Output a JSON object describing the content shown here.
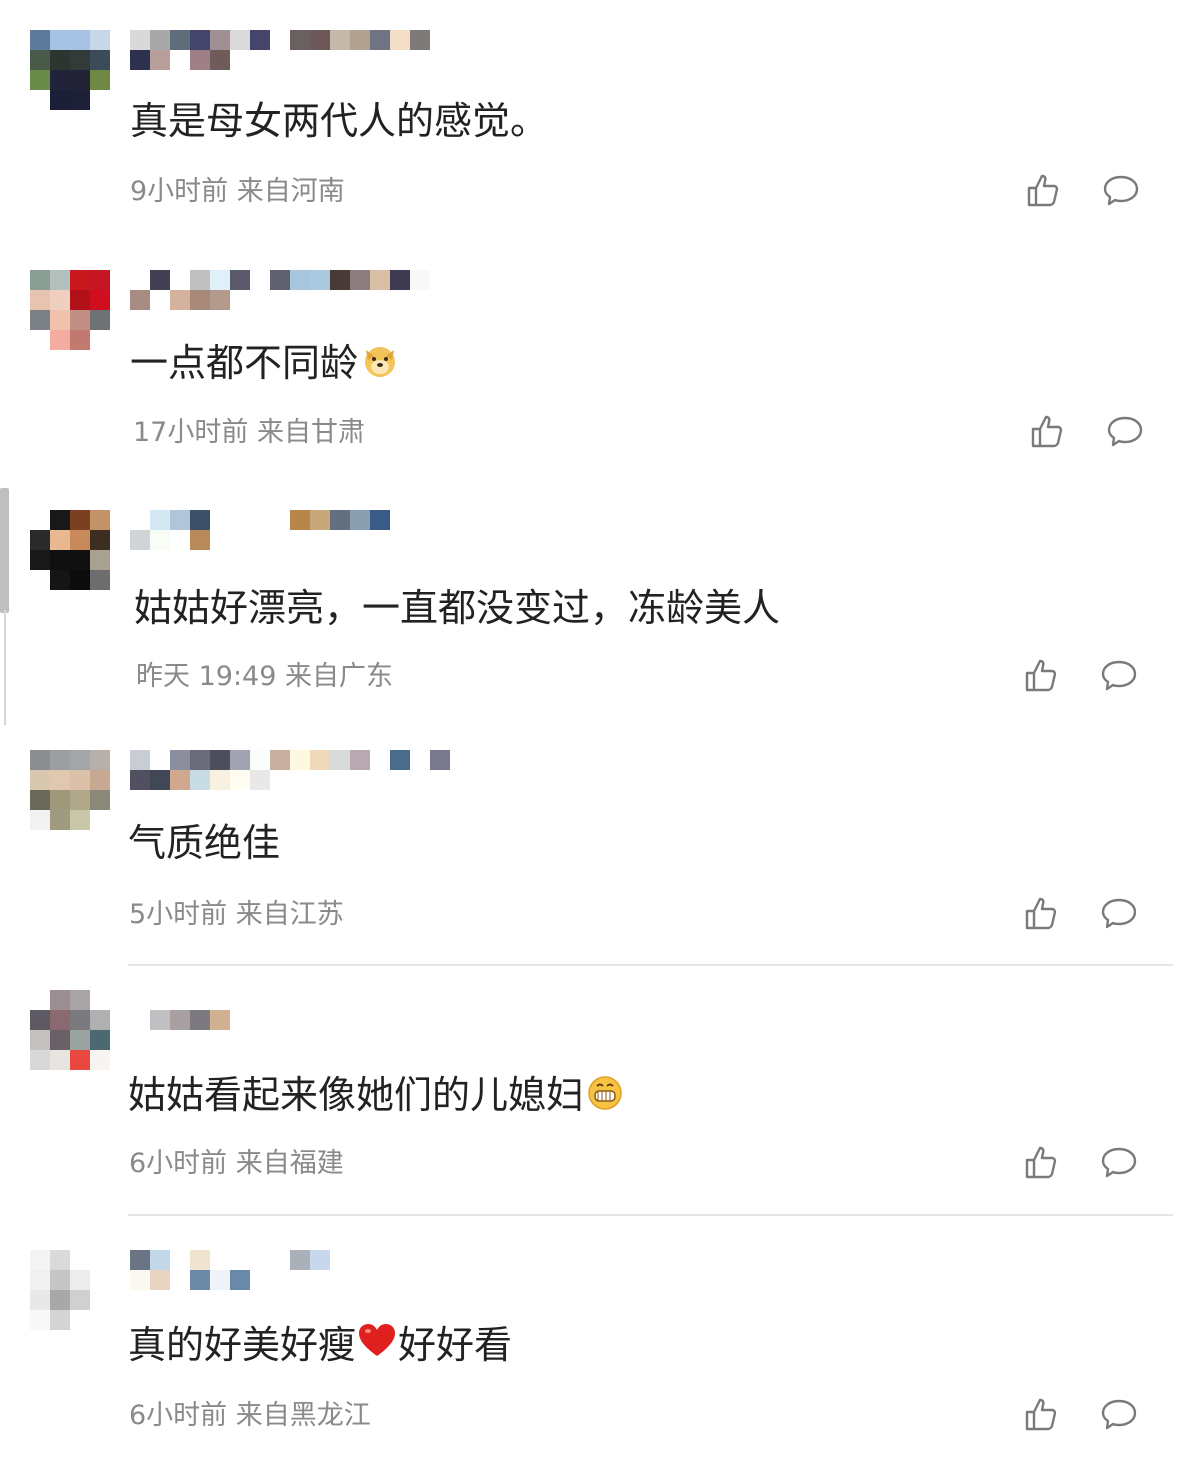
{
  "comments": [
    {
      "text": "真是母女两代人的感觉。",
      "meta": "9小时前 来自河南",
      "avatar": [
        "#5d7a9d",
        "#a7c3e4",
        "#a6c3e4",
        "#c7d7ea",
        "#4a5a48",
        "#2d3530",
        "#333a3a",
        "#3b4b57",
        "#6a8a4a",
        "#21233a",
        "#232338",
        "#6f8844",
        "#ffffff",
        "#1c1f38",
        "#1e2038",
        "#ffffff"
      ],
      "name": [
        "#d9d9d9",
        "#a8a8a8",
        "#5f6c7a",
        "#45446a",
        "#a08f94",
        "#dadada",
        "#45446a",
        "#ffffff",
        "#6a6060",
        "#6e5758",
        "#c6b8a8",
        "#b0a190",
        "#6f7482",
        "#f3ddc7",
        "#7f7a77",
        "#2e3050",
        "#b89e99",
        "#ffffff",
        "#9f7f86",
        "#6f5b5a"
      ]
    },
    {
      "text": "一点都不同龄",
      "meta": "17小时前 来自甘肃",
      "emoji": "dog",
      "avatar": [
        "#8b9e94",
        "#b4c0bd",
        "#c8181e",
        "#c51723",
        "#e8c4b0",
        "#efd0c0",
        "#b1121a",
        "#cf0e1f",
        "#7c8187",
        "#f0c2ae",
        "#c18f83",
        "#6e7276",
        "#ffffff",
        "#f2aca0",
        "#c27a70",
        "#ffffff"
      ],
      "name": [
        "#ffffff",
        "#404050",
        "#ffffff",
        "#c0c0c0",
        "#e0f0f8",
        "#5a5a6a",
        "#ffffff",
        "#606070",
        "#a5c6dc",
        "#aac9e0",
        "#4a3a36",
        "#8c7c7f",
        "#d9bfa4",
        "#3c3b51",
        "#f8f8f8",
        "#a68c82",
        "#ffffff",
        "#d4b39c",
        "#a9897a",
        "#b49a8c"
      ]
    },
    {
      "text": "姑姑好漂亮，一直都没变过，冻龄美人",
      "meta": "昨天 19:49 来自广东",
      "avatar": [
        "#ffffff",
        "#181818",
        "#7a4020",
        "#c39368",
        "#2a2a2a",
        "#e8b890",
        "#c88a5a",
        "#3c2e20",
        "#181818",
        "#101010",
        "#101010",
        "#a8a090",
        "#ffffff",
        "#151515",
        "#0c0c0c",
        "#6d6d6d"
      ],
      "name": [
        "#ffffff",
        "#d4e8f4",
        "#aec6d8",
        "#3c5068",
        "#ffffff",
        "#ffffff",
        "#ffffff",
        "#ffffff",
        "#b8864a",
        "#c8a878",
        "#647080",
        "#8aa0b0",
        "#3a5a88",
        "#d0d4d8",
        "#f8fdf5",
        "#ffffff",
        "#b88a5a",
        "#ffffff"
      ]
    },
    {
      "text": "气质绝佳",
      "meta": "5小时前 来自江苏",
      "avatar": [
        "#8a8e90",
        "#9aa0a2",
        "#a2a6a8",
        "#b8b0a8",
        "#d8c8b0",
        "#e0c8b0",
        "#dcc0a8",
        "#c8a890",
        "#6a6a5a",
        "#a0987a",
        "#b0a888",
        "#8a8878",
        "#f2f2f2",
        "#a09a80",
        "#c8c8a8",
        "#ffffff"
      ],
      "name": [
        "#c8ccd4",
        "#ffffff",
        "#8a8e9e",
        "#6a6c7a",
        "#4c4e60",
        "#a0a4b0",
        "#fafefa",
        "#c8b0a0",
        "#fdf8e0",
        "#eed8b8",
        "#d8dcd8",
        "#b8a8b0",
        "#ffffff",
        "#4a6c8c",
        "#ffffff",
        "#7a7a8e",
        "#505060",
        "#404858",
        "#d0a890",
        "#c8dce4",
        "#f8f0e0",
        "#fffcf2",
        "#e8e8e8"
      ]
    },
    {
      "text": "姑姑看起来像她们的儿媳妇",
      "meta": "6小时前 来自福建",
      "emoji": "grin",
      "avatar": [
        "#ffffff",
        "#9a8e90",
        "#a8a4a8",
        "#ffffff",
        "#5e5a64",
        "#8a6a70",
        "#7a7a7e",
        "#b0b0b0",
        "#c4c0c0",
        "#6a6068",
        "#9aa2a0",
        "#4a6a70",
        "#d8d8d8",
        "#e8e4e0",
        "#e84840",
        "#f8f4f0"
      ],
      "name": [
        "#ffffff",
        "#c0c0c4",
        "#a8a0a0",
        "#7c7a80",
        "#d0b090"
      ]
    },
    {
      "text": "真的好美好瘦",
      "text2": "好好看",
      "meta": "6小时前 来自黑龙江",
      "emoji": "heart",
      "avatar": [
        "#f4f4f4",
        "#dadada",
        "#ffffff",
        "#ffffff",
        "#f0f0f0",
        "#c6c6c6",
        "#ececec",
        "#ffffff",
        "#e8e8e8",
        "#a8a8a8",
        "#d0d0d0",
        "#ffffff",
        "#f8f8f8",
        "#d4d4d4",
        "#ffffff",
        "#ffffff"
      ],
      "name": [
        "#6a7484",
        "#c2d8e8",
        "#ffffff",
        "#f0e4d0",
        "#ffffff",
        "#ffffff",
        "#ffffff",
        "#ffffff",
        "#aab0b8",
        "#c8d8ec",
        "#fcf8f0",
        "#e8d4c0",
        "#ffffff",
        "#6a8aa8",
        "#f0f4f8",
        "#6a88a8"
      ]
    }
  ]
}
